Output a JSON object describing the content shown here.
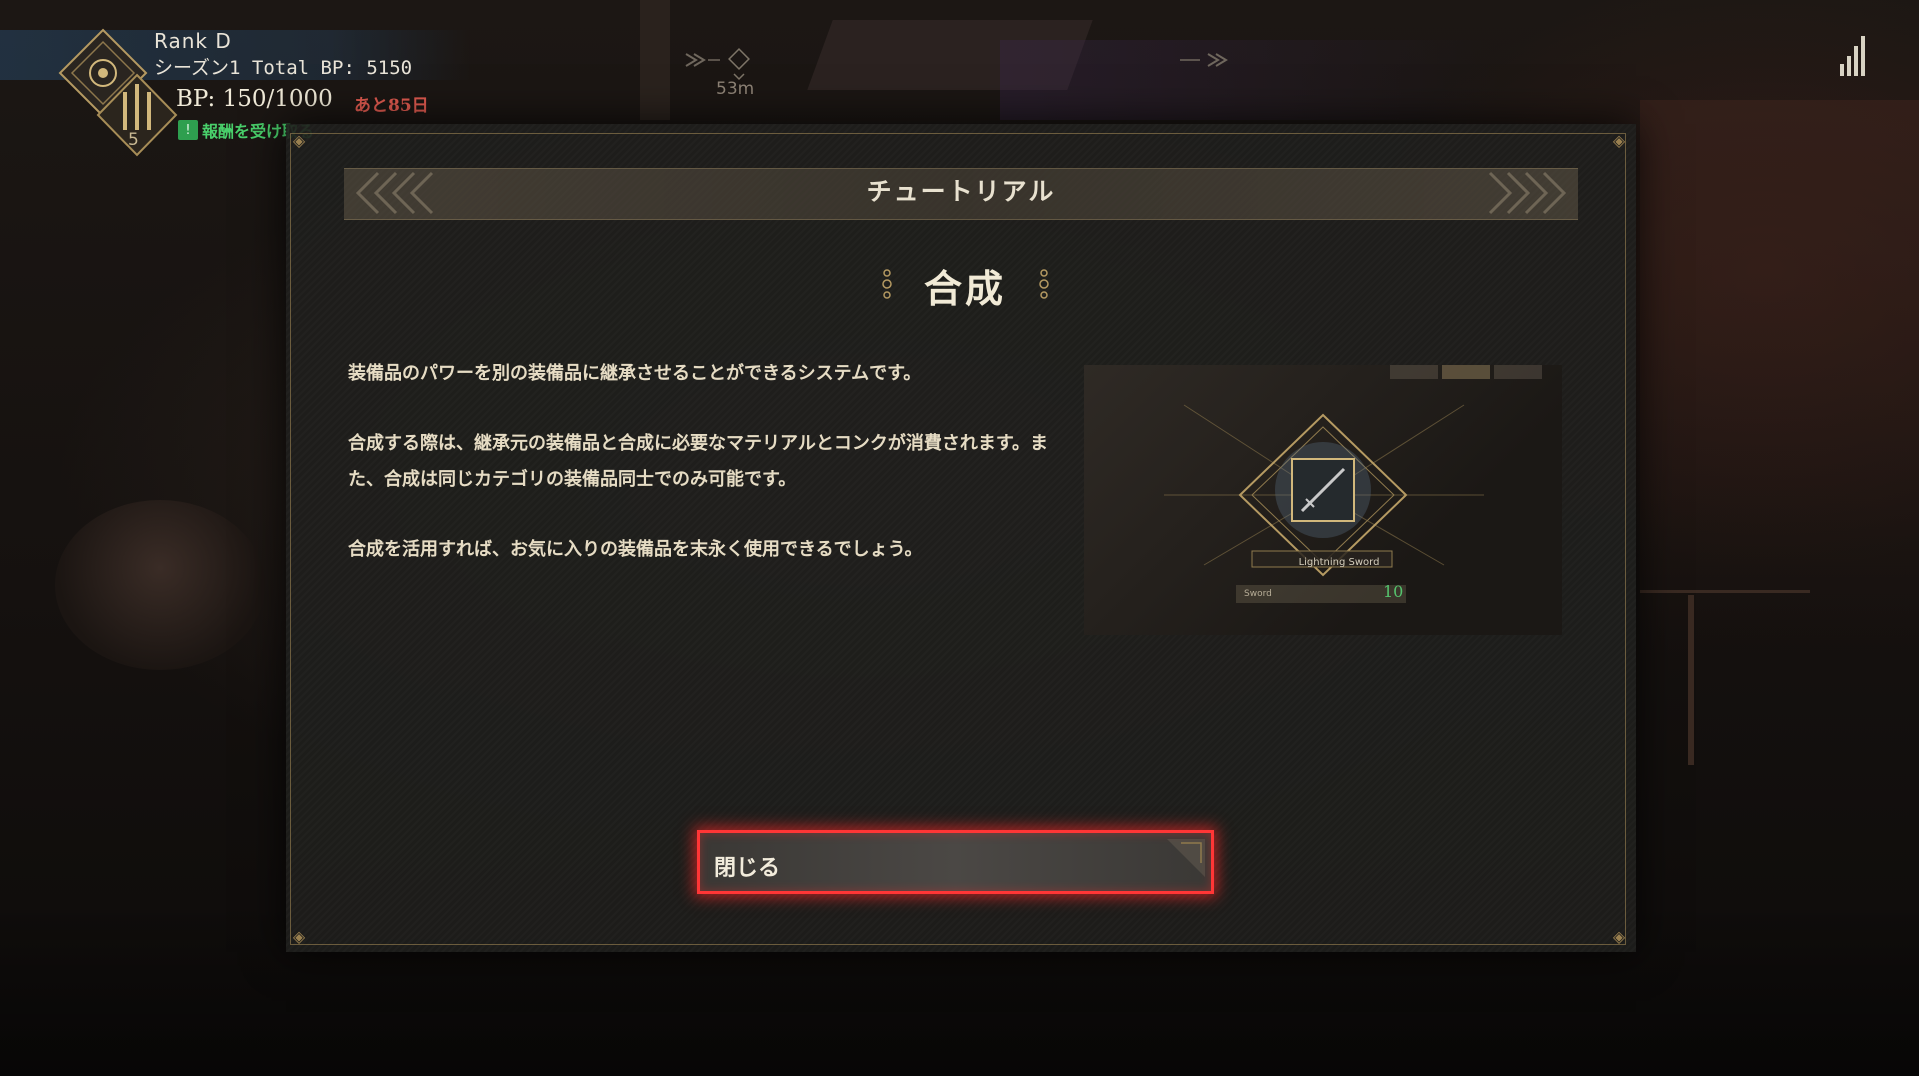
{
  "hud": {
    "rank": "Rank D",
    "season_total": "シーズン1 Total BP: 5150",
    "bp": "BP: 150/1000",
    "days_left": "あと85日",
    "claim_badge": "!",
    "claim_label": "報酬を受け取る",
    "level": "5"
  },
  "compass": {
    "distance": "53m"
  },
  "dialog": {
    "band_title": "チュートリアル",
    "heading": "合成",
    "paragraphs": [
      "装備品のパワーを別の装備品に継承させることができるシステムです。",
      "合成する際は、継承元の装備品と合成に必要なマテリアルとコンクが消費されます。また、合成は同じカテゴリの装備品同士でのみ可能です。",
      "合成を活用すれば、お気に入りの装備品を末永く使用できるでしょう。"
    ],
    "close_label": "閉じる"
  },
  "preview": {
    "item_name": "Lightning Sword",
    "category": "Sword",
    "level": "10"
  },
  "colors": {
    "accent_gold": "#ab8f5a",
    "close_highlight": "#ff3636",
    "claim_green": "#49d06b",
    "days_red": "#e05a4f"
  }
}
